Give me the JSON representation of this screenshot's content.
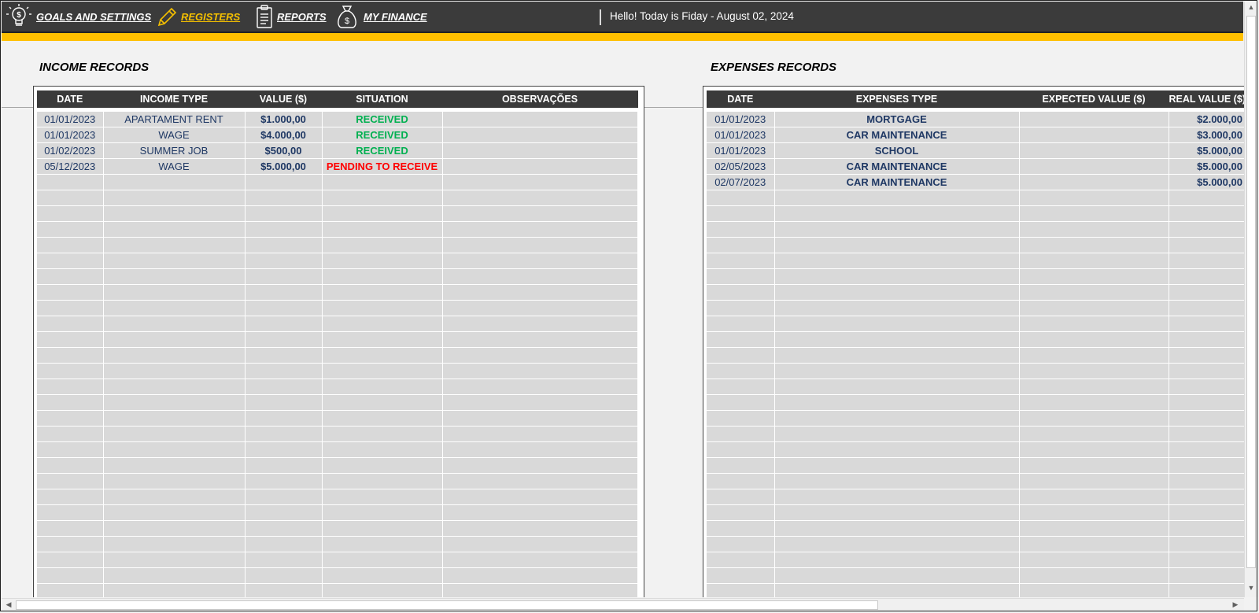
{
  "nav": {
    "items": [
      {
        "label": "GOALS AND SETTINGS",
        "icon": "lightbulb-dollar-icon"
      },
      {
        "label": "REGISTERS",
        "icon": "pencil-icon"
      },
      {
        "label": "REPORTS",
        "icon": "clipboard-icon"
      },
      {
        "label": "MY FINANCE",
        "icon": "money-bag-icon"
      }
    ],
    "greeting": "Hello! Today is Fiday - August 02, 2024"
  },
  "colors": {
    "accent": "#ffc000",
    "topbar": "#3b3b3b",
    "received": "#00b050",
    "pending": "#ff0000",
    "value_text": "#1f3864"
  },
  "income": {
    "title": "INCOME RECORDS",
    "headers": [
      "DATE",
      "INCOME TYPE",
      "VALUE ($)",
      "SITUATION",
      "OBSERVAÇÕES"
    ],
    "rows": [
      [
        "01/01/2023",
        "APARTAMENT RENT",
        "$1.000,00",
        "RECEIVED",
        ""
      ],
      [
        "01/01/2023",
        "WAGE",
        "$4.000,00",
        "RECEIVED",
        ""
      ],
      [
        "01/02/2023",
        "SUMMER JOB",
        "$500,00",
        "RECEIVED",
        ""
      ],
      [
        "05/12/2023",
        "WAGE",
        "$5.000,00",
        "PENDING TO RECEIVE",
        ""
      ]
    ]
  },
  "expenses": {
    "title": "EXPENSES RECORDS",
    "headers": [
      "DATE",
      "EXPENSES TYPE",
      "EXPECTED VALUE ($)",
      "REAL VALUE ($)"
    ],
    "rows": [
      [
        "01/01/2023",
        "MORTGAGE",
        "",
        "$2.000,00"
      ],
      [
        "01/01/2023",
        "CAR MAINTENANCE",
        "",
        "$3.000,00"
      ],
      [
        "01/01/2023",
        "SCHOOL",
        "",
        "$5.000,00"
      ],
      [
        "02/05/2023",
        "CAR MAINTENANCE",
        "",
        "$5.000,00"
      ],
      [
        "02/07/2023",
        "CAR MAINTENANCE",
        "",
        "$5.000,00"
      ]
    ]
  }
}
